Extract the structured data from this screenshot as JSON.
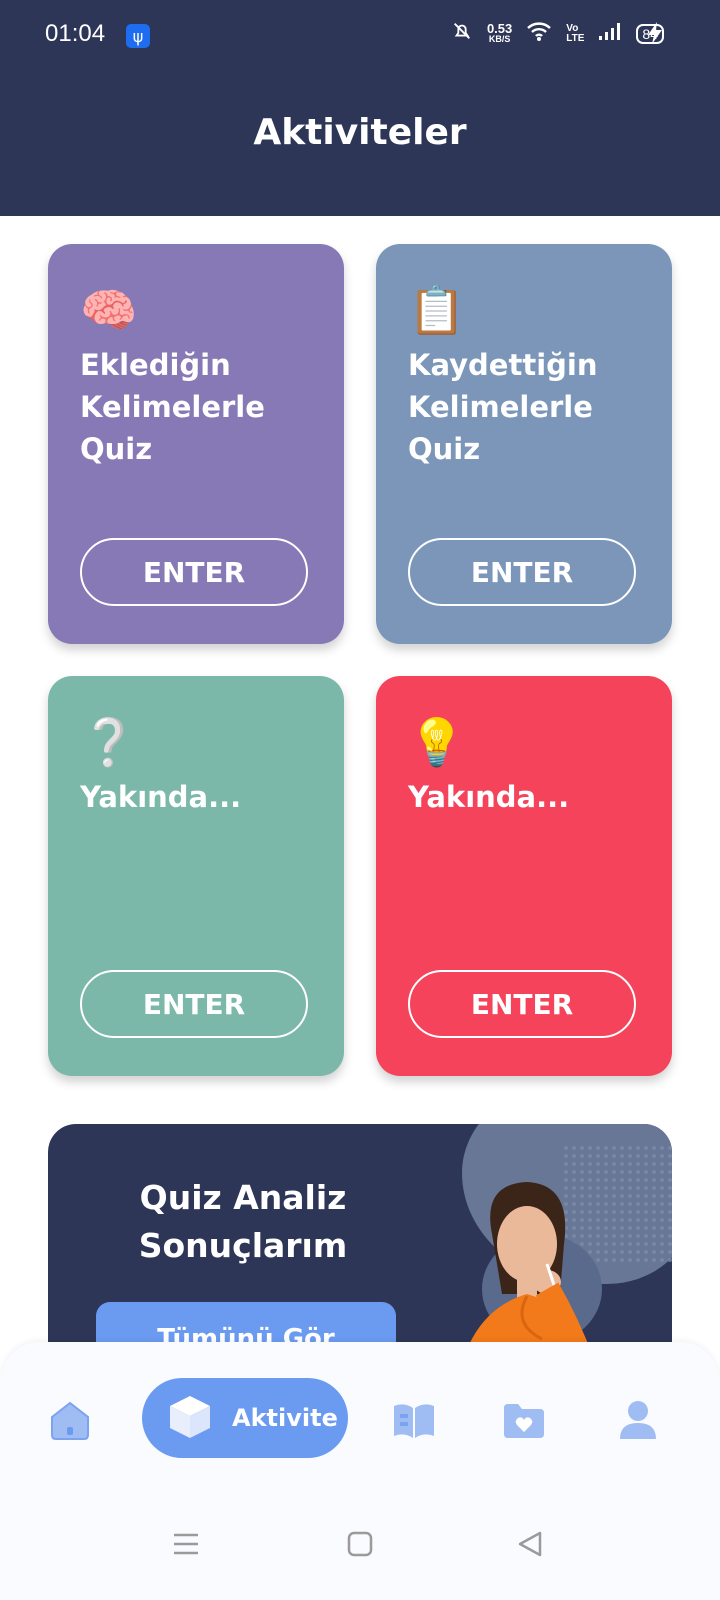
{
  "status_bar": {
    "time": "01:04",
    "net_speed_value": "0.53",
    "net_speed_unit": "KB/S",
    "volte_top": "Vo",
    "volte_bottom": "LTE",
    "battery": "84"
  },
  "header": {
    "title": "Aktiviteler"
  },
  "cards": [
    {
      "icon": "brain-icon",
      "emoji": "🧠",
      "title": "Eklediğin Kelimelerle Quiz",
      "button": "ENTER",
      "color": "#8679b6"
    },
    {
      "icon": "clipboard-icon",
      "emoji": "📋",
      "title": "Kaydettiğin Kelimelerle Quiz",
      "button": "ENTER",
      "color": "#7b96b9"
    },
    {
      "icon": "question-icon",
      "emoji": "❔",
      "title": "Yakında...",
      "button": "ENTER",
      "color": "#7bb8aa"
    },
    {
      "icon": "lightbulb-icon",
      "emoji": "💡",
      "title": "Yakında...",
      "button": "ENTER",
      "color": "#f4435b"
    }
  ],
  "banner": {
    "title": "Quiz Analiz Sonuçlarım",
    "button": "Tümünü Gör"
  },
  "bottom_nav": {
    "active_label": "Aktivite",
    "items": [
      "home-icon",
      "cube-icon",
      "book-icon",
      "folder-heart-icon",
      "user-icon"
    ]
  },
  "colors": {
    "header_bg": "#2e3658",
    "accent_blue": "#6b9af1"
  }
}
